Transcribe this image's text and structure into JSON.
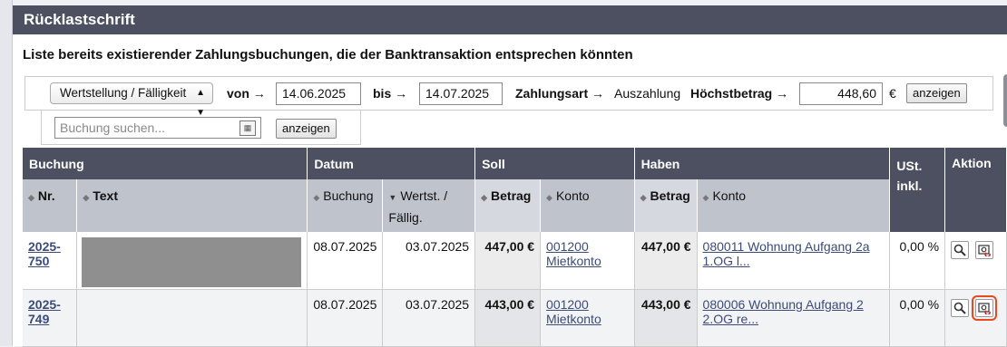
{
  "window": {
    "title": "Rücklastschrift"
  },
  "heading": "Liste bereits existierender Zahlungsbuchungen, die der Banktransaktion entsprechen könnten",
  "filter": {
    "select_value": "Wertstellung / Fälligkeit",
    "von_label": "von →",
    "von_value": "14.06.2025",
    "bis_label": "bis →",
    "bis_value": "14.07.2025",
    "zahlungsart_label": "Zahlungsart →",
    "zahlungsart_value": "Auszahlung",
    "hoechstbetrag_label": "Höchstbetrag →",
    "hoechstbetrag_value": "448,60",
    "currency": "€",
    "show_button": "anzeigen"
  },
  "search": {
    "placeholder": "Buchung suchen...",
    "show_button": "anzeigen"
  },
  "table": {
    "group_headers": {
      "buchung": "Buchung",
      "datum": "Datum",
      "soll": "Soll",
      "haben": "Haben",
      "ust": "USt. inkl.",
      "aktion": "Aktion"
    },
    "column_headers": {
      "nr": "Nr.",
      "text": "Text",
      "buchung_datum": "Buchung",
      "wertst": "Wertst. / Fällig.",
      "soll_betrag": "Betrag",
      "soll_konto": "Konto",
      "haben_betrag": "Betrag",
      "haben_konto": "Konto"
    },
    "rows": [
      {
        "nr": "2025-750",
        "buchung_datum": "08.07.2025",
        "wertst": "03.07.2025",
        "soll_betrag": "447,00 €",
        "soll_konto": "001200 Mietkonto",
        "haben_betrag": "447,00 €",
        "haben_konto": "080011 Wohnung Aufgang 2a 1.OG l...",
        "ust": "0,00 %"
      },
      {
        "nr": "2025-749",
        "buchung_datum": "08.07.2025",
        "wertst": "03.07.2025",
        "soll_betrag": "443,00 €",
        "soll_konto": "001200 Mietkonto",
        "haben_betrag": "443,00 €",
        "haben_konto": "080006 Wohnung Aufgang 2 2.OG re...",
        "ust": "0,00 %"
      }
    ]
  },
  "icons": {
    "view": "magnifier-icon",
    "link": "link-payment-icon",
    "accent": "#e8491f",
    "header_bg": "#4c5061"
  }
}
